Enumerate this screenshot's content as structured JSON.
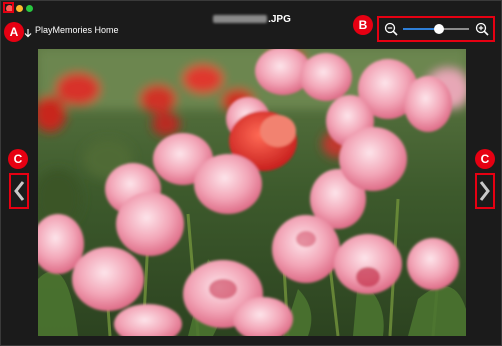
{
  "window": {
    "file_name_suffix": ".JPG",
    "app_title": "PlayMemories Home"
  },
  "callouts": {
    "a": "A",
    "b": "B",
    "c_left": "C",
    "c_right": "C"
  },
  "zoom": {
    "level_fraction": 0.55
  },
  "icons": {
    "zoom_out": "zoom-out-magnifier-icon",
    "zoom_in": "zoom-in-magnifier-icon",
    "previous": "chevron-left-icon",
    "next": "chevron-right-icon",
    "export": "download-arrow-icon"
  },
  "colors": {
    "callout_red": "#e60012",
    "slider_blue": "#2e7fd8",
    "background": "#1b1b1b"
  }
}
